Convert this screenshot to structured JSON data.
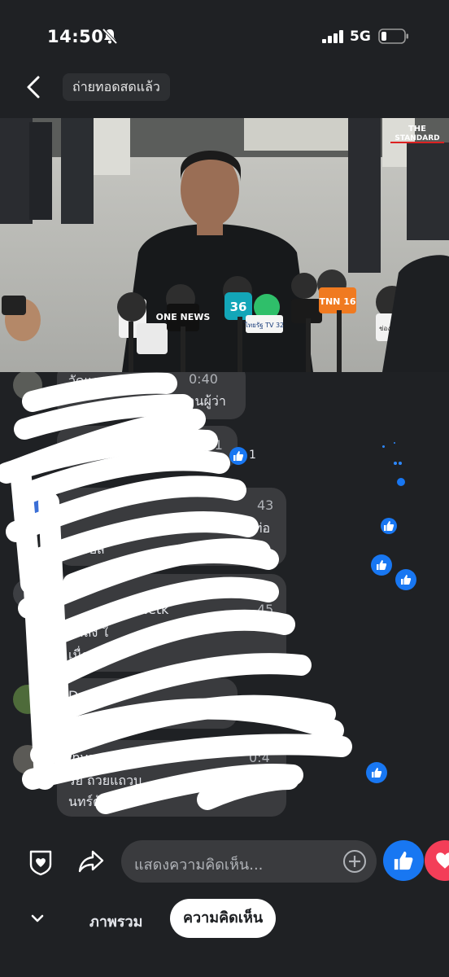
{
  "status_bar": {
    "time": "14:50",
    "network": "5G"
  },
  "nav": {
    "live_label": "ถ่ายทอดสดแล้ว"
  },
  "video": {
    "watermark_line1": "THE",
    "watermark_line2": "STANDARD",
    "mic_labels": [
      "ONE NEWS",
      "36",
      "ไทยรัฐ TV 32",
      "TNN 16",
      "ช่อง 7HD"
    ]
  },
  "comments": [
    {
      "name": "วัดแสง",
      "time": "0:40",
      "text": "ท่านผู้ว่า"
    },
    {
      "name": "",
      "time": "0:41",
      "text": "",
      "reaction_count": "1"
    },
    {
      "name": "",
      "time": "43",
      "text_line1": "ท่อ",
      "text_line2": "ร์ปล"
    },
    {
      "name": "Netk",
      "time": "45",
      "text_line1": "กำลัง ใ",
      "text_line2": "เนื่อ ะคพ"
    },
    {
      "name": "Dan",
      "time": "",
      "text": ""
    },
    {
      "name": "inyar ongkolch",
      "time": "0:4",
      "text_line1": "รีย ถ้วยแถวบ",
      "text_line2": "นทร์ด้วยค่ะ"
    }
  ],
  "composer": {
    "placeholder": "แสดงความคิดเห็น..."
  },
  "tabs": {
    "overview": "ภาพรวม",
    "comments": "ความคิดเห็น"
  },
  "colors": {
    "background": "#1f2124",
    "accent": "#1877f2",
    "love": "#f33e58",
    "bubble": "#3a3b3e"
  }
}
